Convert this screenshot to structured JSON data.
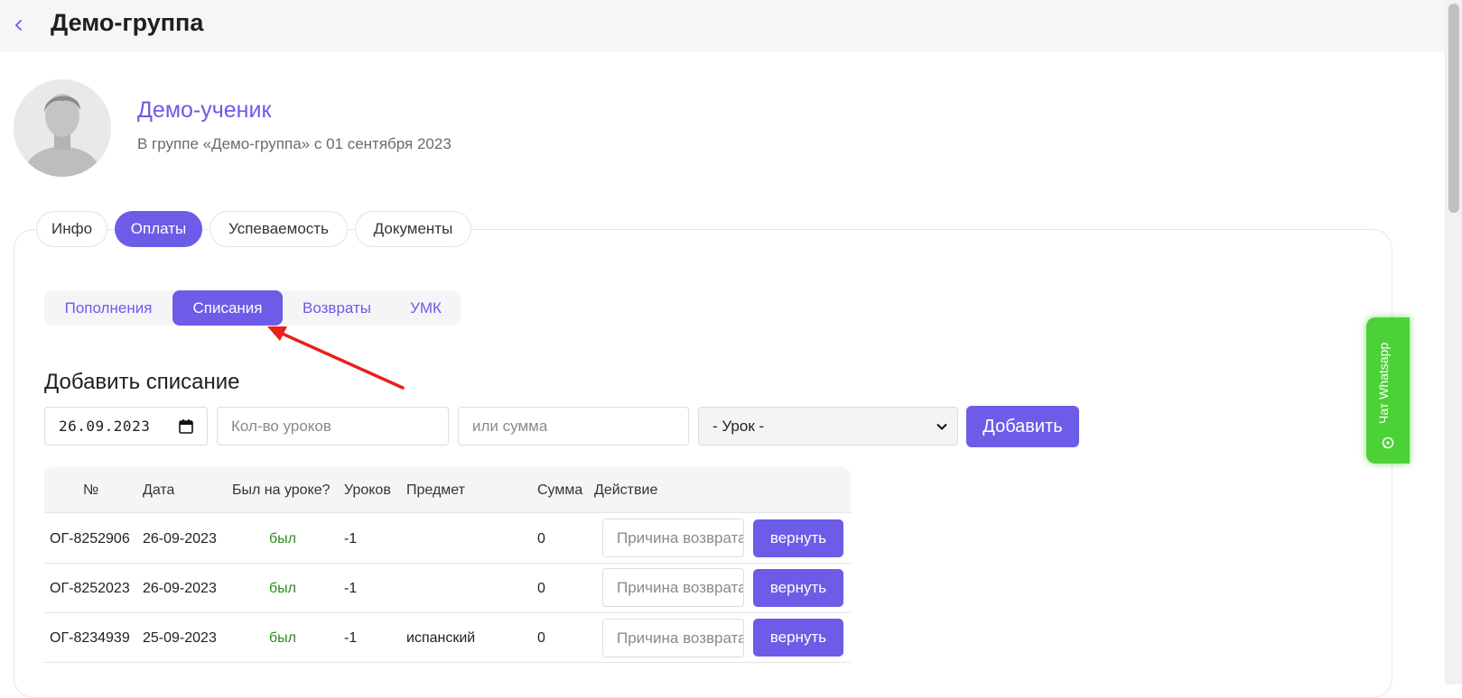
{
  "header": {
    "title": "Демо-группа"
  },
  "profile": {
    "name": "Демо-ученик",
    "subtitle": "В группе «Демо-группа» с 01 сентября 2023"
  },
  "main_tabs": [
    {
      "label": "Инфо",
      "active": false
    },
    {
      "label": "Оплаты",
      "active": true
    },
    {
      "label": "Успеваемость",
      "active": false
    },
    {
      "label": "Документы",
      "active": false
    }
  ],
  "sub_tabs": [
    {
      "label": "Пополнения",
      "active": false
    },
    {
      "label": "Списания",
      "active": true
    },
    {
      "label": "Возвраты",
      "active": false
    },
    {
      "label": "УМК",
      "active": false
    }
  ],
  "form": {
    "section_title": "Добавить списание",
    "date_value": "26.09.2023",
    "lessons_placeholder": "Кол-во уроков",
    "sum_placeholder": "или сумма",
    "lesson_select_value": "- Урок -",
    "add_label": "Добавить"
  },
  "table": {
    "headers": [
      "№",
      "Дата",
      "Был на уроке?",
      "Уроков",
      "Предмет",
      "Сумма",
      "Действие"
    ],
    "rows": [
      {
        "id": "ОГ-8252906",
        "date": "26-09-2023",
        "attended": "был",
        "lessons": "-1",
        "subject": "",
        "sum": "0",
        "reason_placeholder": "Причина возврата",
        "action": "вернуть"
      },
      {
        "id": "ОГ-8252023",
        "date": "26-09-2023",
        "attended": "был",
        "lessons": "-1",
        "subject": "",
        "sum": "0",
        "reason_placeholder": "Причина возврата",
        "action": "вернуть"
      },
      {
        "id": "ОГ-8234939",
        "date": "25-09-2023",
        "attended": "был",
        "lessons": "-1",
        "subject": "испанский",
        "sum": "0",
        "reason_placeholder": "Причина возврата",
        "action": "вернуть"
      }
    ]
  },
  "whatsapp": {
    "label": "Чат Whatsapp"
  },
  "colors": {
    "accent": "#6c5ce7",
    "attended": "#2e8b1d",
    "whatsapp": "#4cd137",
    "arrow": "#e8201a"
  }
}
